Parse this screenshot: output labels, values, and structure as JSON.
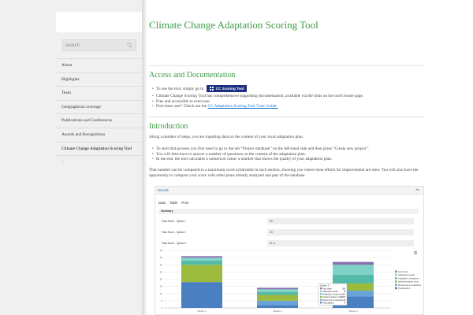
{
  "sidebar": {
    "search": {
      "placeholder": "search"
    },
    "nav": [
      {
        "label": "About"
      },
      {
        "label": "Highlights"
      },
      {
        "label": "Team"
      },
      {
        "label": "Geographical coverage"
      },
      {
        "label": "Publications and Conferences"
      },
      {
        "label": "Awards and Recognitions"
      },
      {
        "label": "Climate Change Adaptation Scoring Tool",
        "active": true
      }
    ],
    "more": "..."
  },
  "main": {
    "title": "Climate Change Adaptation Scoring Tool",
    "access": {
      "heading": "Access and Documentation",
      "use_prefix": "To use the tool, simply go to",
      "button_label": "CC Scoring Tool",
      "items": [
        "Climate Change Scoring Tool has comprehensive supporting documentation, available via the links on the tool's home page.",
        "Free and accessible to everyone."
      ],
      "guide_prefix": "First-time user? Check out the",
      "guide_link": "CC Adaptation Scoring Tool 'User Guide'."
    },
    "intro": {
      "heading": "Introduction",
      "para1": "Along a number of steps, you are inputting data on the content of your local adaptation plan.",
      "items": [
        "To start that process you first need to go to the tab “Project database” on the left-hand side and then press “Create new project”.",
        "You will then have to answer a number of questions on the content of the adaptation plan.",
        "In the end, the tool calculates a numerical value/ a number that shows the quality of your adaptation plan."
      ],
      "para2_line1": "That number can be compared to a maximum score achievable in each section, showing you where most efforts for improvement are seen. You will also have the",
      "para2_line2": "opportunity to compare your score with other plans already analyzed and part of the database."
    }
  },
  "results": {
    "title": "Results",
    "tabs": [
      "Data",
      "Table",
      "Print"
    ],
    "summary_label": "Summary",
    "scores": [
      {
        "label": "Total Score - Option 1",
        "value": "36"
      },
      {
        "label": "Total Score - Option 2",
        "value": "15"
      },
      {
        "label": "Total Score - Option 3",
        "value": "31.5"
      }
    ]
  },
  "chart_data": {
    "type": "bar",
    "stacked": true,
    "categories": [
      "Option 1",
      "Option 2",
      "Option 3"
    ],
    "ylim": [
      0,
      40
    ],
    "yticks": [
      0,
      5,
      10,
      15,
      20,
      25,
      30,
      35,
      40
    ],
    "series": [
      {
        "name": "Participation",
        "color": "#4a7fc1",
        "values": [
          18,
          2,
          8
        ]
      },
      {
        "name": "Monitoring & evaluation",
        "color": "#6aa3d8",
        "values": [
          0,
          3,
          4
        ]
      },
      {
        "name": "Implementation tools",
        "color": "#9cbb3c",
        "values": [
          12,
          4,
          5
        ]
      },
      {
        "name": "Adaptation measures",
        "color": "#55b9a8",
        "values": [
          3,
          2,
          6
        ]
      },
      {
        "name": "Adaptation goals",
        "color": "#7fd3c6",
        "values": [
          2,
          2,
          7
        ]
      },
      {
        "name": "Fact base",
        "color": "#8a6fb0",
        "values": [
          1,
          1,
          2
        ]
      }
    ],
    "legend_position": "right",
    "tooltip": {
      "title": "Option 3",
      "rows": [
        {
          "label": "Fact base:",
          "value": "5.5"
        },
        {
          "label": "Adaptation goals:",
          "value": "8"
        },
        {
          "label": "Adaptation measures:",
          "value": "6.1"
        },
        {
          "label": "Implementation tools:",
          "value": "12.7"
        },
        {
          "label": "Monitoring & evaluation:",
          "value": "0"
        },
        {
          "label": "Participation:",
          "value": "4"
        }
      ]
    }
  }
}
